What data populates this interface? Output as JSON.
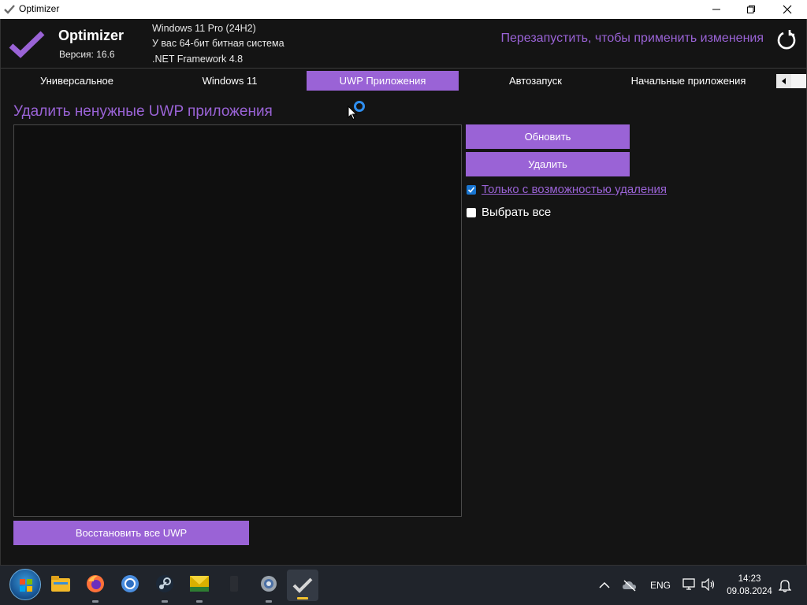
{
  "window": {
    "title": "Optimizer",
    "controls": [
      "minimize-icon",
      "restore-icon",
      "close-icon"
    ]
  },
  "header": {
    "app_name": "Optimizer",
    "version": "Версия: 16.6",
    "os": "Windows 11 Pro (24H2)",
    "arch": "У вас 64-бит битная система",
    "framework": ".NET Framework 4.8",
    "restart_text": "Перезапустить, чтобы применить изменения",
    "accent_color": "#9a63d6"
  },
  "tabs": [
    {
      "label": "Универсальное",
      "active": false
    },
    {
      "label": "Windows 11",
      "active": false
    },
    {
      "label": "UWP Приложения",
      "active": true
    },
    {
      "label": "Автозапуск",
      "active": false
    },
    {
      "label": "Начальные приложения",
      "active": false
    }
  ],
  "main": {
    "title": "Удалить ненужные UWP приложения",
    "refresh_button": "Обновить",
    "delete_button": "Удалить",
    "only_removable_label": "Только с возможностью удаления",
    "only_removable_checked": true,
    "select_all_label": "Выбрать все",
    "select_all_checked": false,
    "restore_button": "Восстановить все UWP",
    "app_list_items": []
  },
  "taskbar": {
    "pinned": [
      "start-orb",
      "explorer-icon",
      "firefox-icon",
      "chrome-icon",
      "steam-icon",
      "mail-icon",
      "app-icon",
      "settings-icon",
      "optimizer-icon"
    ],
    "language": "ENG",
    "time": "14:23",
    "date": "09.08.2024"
  }
}
